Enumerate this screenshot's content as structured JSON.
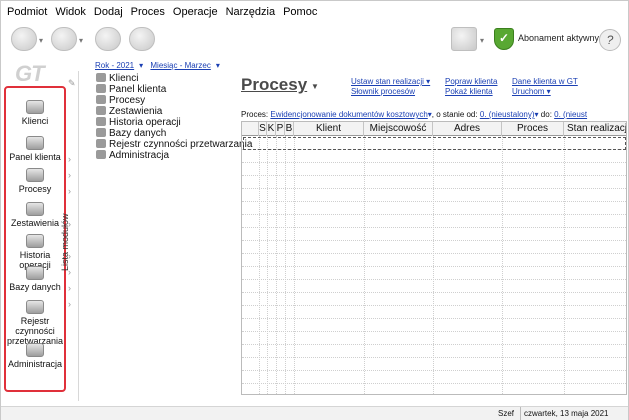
{
  "menu": [
    "Podmiot",
    "Widok",
    "Dodaj",
    "Proces",
    "Operacje",
    "Narzędzia",
    "Pomoc"
  ],
  "toolbar": {
    "icons": [
      "navigation-back-icon",
      "navigation-forward-icon",
      "refresh-icon",
      "stop-icon",
      "window-icon"
    ],
    "subscription_label": "Abonament aktywny",
    "subscription_color": "#58a832"
  },
  "period": {
    "year": "Rok - 2021",
    "month": "Miesiąc - Marzec"
  },
  "leftnav": {
    "items": [
      "Klienci",
      "Panel klienta",
      "Procesy",
      "Zestawienia",
      "Historia operacji",
      "Bazy danych",
      "Rejestr czynności przetwarzania",
      "Administracja"
    ],
    "border_color": "#e0303a"
  },
  "strip_label": "Lista modułów",
  "tree": [
    "Klienci",
    "Panel klienta",
    "Procesy",
    "Zestawienia",
    "Historia operacji",
    "Bazy danych",
    "Rejestr czynności przetwarzania",
    "Administracja"
  ],
  "main": {
    "title": "Procesy",
    "links": {
      "set_status": "Ustaw stan realizacji",
      "dict": "Słownik procesów",
      "fix_client": "Popraw klienta",
      "show_client": "Pokaż klienta",
      "client_data": "Dane klienta w GT",
      "run": "Uruchom"
    },
    "filter": {
      "label": "Proces:",
      "process": "Ewidencjonowanie dokumentów kosztowych",
      "from_label": ", o stanie od:",
      "from_value": "0. (nieustalony)",
      "to_label": "do:",
      "to_value": "0. (nieust"
    },
    "columns": [
      "S",
      "K",
      "P",
      "B",
      "Klient",
      "Miejscowość",
      "Adres",
      "Proces",
      "Stan realizacji"
    ]
  },
  "status": {
    "user": "Szef",
    "date": "czwartek, 13 maja 2021"
  }
}
